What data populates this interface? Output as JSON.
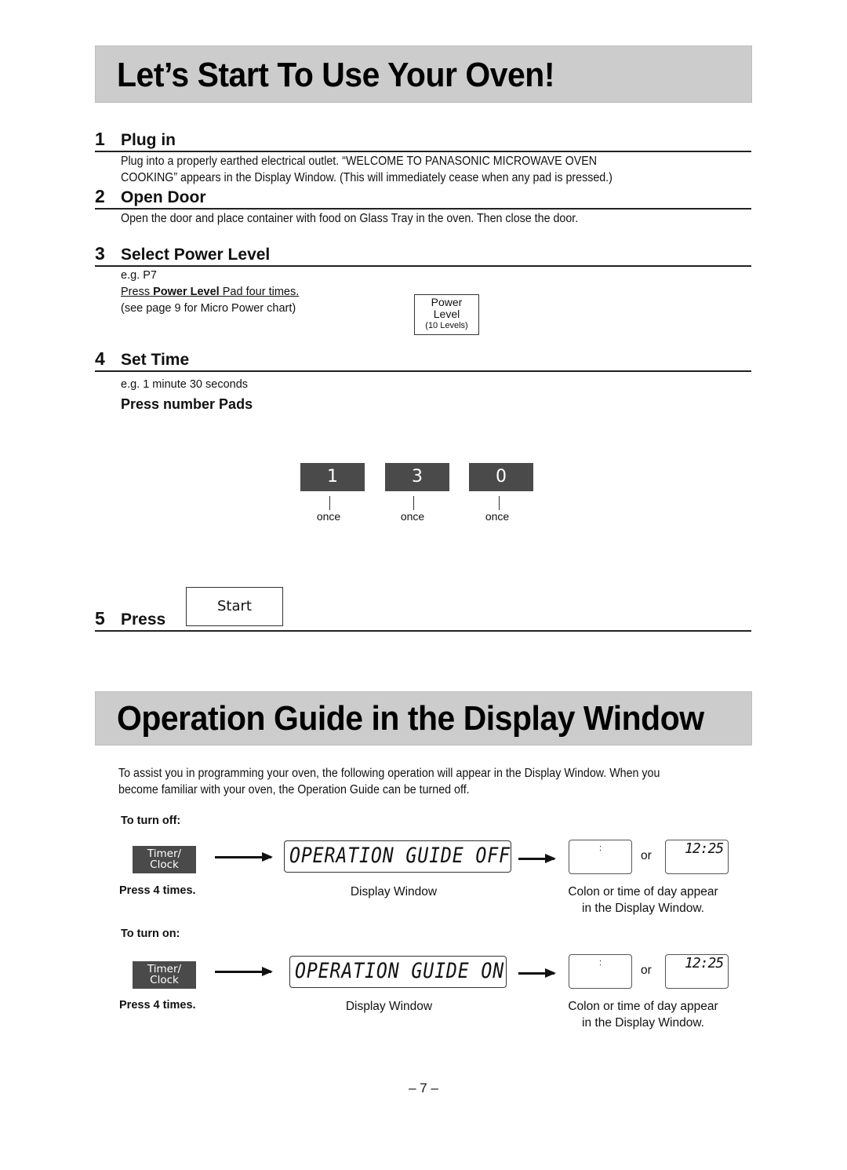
{
  "section1": {
    "title": "Let’s Start To Use Your Oven!",
    "steps": [
      {
        "number": "1",
        "title": "Plug in",
        "lines": [
          "Plug into a properly earthed electrical outlet. “WELCOME TO PANASONIC MICROWAVE OVEN",
          "COOKING” appears in the Display Window. (This will immediately cease when any pad is pressed.)"
        ]
      },
      {
        "number": "2",
        "title": "Open Door",
        "lines": [
          "Open the door and place container with food on Glass Tray in the oven. Then close the door."
        ]
      },
      {
        "number": "3",
        "title": "Select Power Level",
        "example": "e.g. P7",
        "instruction_prefix": "Press ",
        "instruction_bold": "Power Level",
        "instruction_suffix": " Pad four times.",
        "note": "(see page 9 for Micro Power chart)",
        "pad": {
          "line1": "Power",
          "line2": "Level",
          "line3": "(10 Levels)"
        }
      },
      {
        "number": "4",
        "title": "Set Time",
        "example": "e.g. 1 minute 30 seconds",
        "subheading": "Press number Pads",
        "pads": [
          {
            "label": "1",
            "count": "once"
          },
          {
            "label": "3",
            "count": "once"
          },
          {
            "label": "0",
            "count": "once"
          }
        ]
      },
      {
        "number": "5",
        "title": "Press",
        "pad": "Start"
      }
    ]
  },
  "section2": {
    "title": "Operation Guide in the Display Window",
    "intro_lines": [
      "To assist you in programming your oven, the following operation will appear in the Display Window. When you",
      "become familiar with your oven, the Operation Guide can be turned off."
    ],
    "turn_off": {
      "label": "To turn off:",
      "pad": {
        "line1": "Timer/",
        "line2": "Clock"
      },
      "press_note": "Press 4 times.",
      "display_text": "OPERATION GUIDE OFF",
      "display_caption": "Display Window",
      "colon_display": ":",
      "or": "or",
      "time_display": "12:25",
      "result_caption_lines": [
        "Colon or time of day appear",
        "in the Display Window."
      ]
    },
    "turn_on": {
      "label": "To turn on:",
      "pad": {
        "line1": "Timer/",
        "line2": "Clock"
      },
      "press_note": "Press 4 times.",
      "display_text": "OPERATION GUIDE ON",
      "display_caption": "Display Window",
      "colon_display": ":",
      "or": "or",
      "time_display": "12:25",
      "result_caption_lines": [
        "Colon or time of day appear",
        "in the Display Window."
      ]
    }
  },
  "page_number": "– 7 –",
  "colors": {
    "banner_bg": "#cccccc",
    "pad_dark": "#4a4a4a",
    "text": "#111111"
  }
}
